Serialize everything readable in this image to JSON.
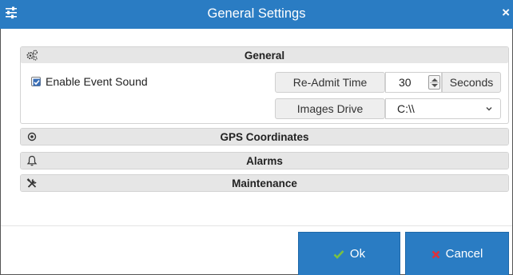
{
  "dialog": {
    "title": "General Settings",
    "close_glyph": "×",
    "menu_icon": "settings-sliders-icon",
    "accent_color": "#2a7cc3"
  },
  "general": {
    "title": "General",
    "icon": "gears-icon",
    "enable_event_sound": {
      "label": "Enable Event Sound",
      "checked": true
    },
    "readmit_time": {
      "label": "Re-Admit Time",
      "value": "30",
      "units": "Seconds"
    },
    "images_drive": {
      "label": "Images Drive",
      "value": "C:\\\\"
    }
  },
  "sections": {
    "gps": {
      "title": "GPS Coordinates",
      "icon": "target-icon"
    },
    "alarms": {
      "title": "Alarms",
      "icon": "bell-icon"
    },
    "maintenance": {
      "title": "Maintenance",
      "icon": "tools-icon"
    }
  },
  "buttons": {
    "ok": {
      "label": "Ok",
      "icon": "check-icon",
      "icon_color": "#7ac142"
    },
    "cancel": {
      "label": "Cancel",
      "icon": "x-icon",
      "icon_color": "#e0303a"
    }
  }
}
